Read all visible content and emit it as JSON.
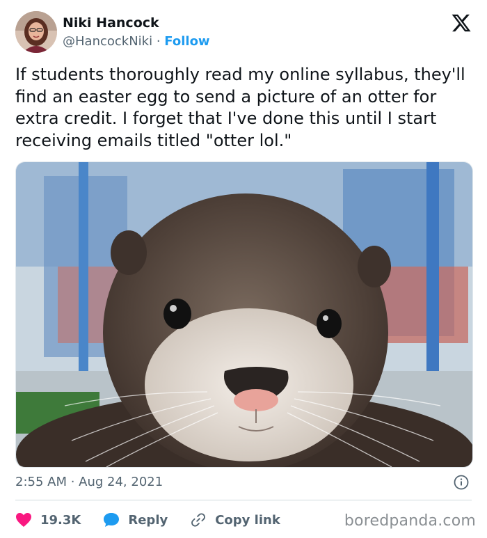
{
  "author": {
    "name": "Niki Hancock",
    "handle": "@HancockNiki",
    "separator": "·",
    "follow_label": "Follow"
  },
  "tweet": {
    "text": "If students thoroughly read my online syllabus, they'll find an easter egg to send a picture of an otter for extra credit. I forget that I've done this until I start receiving emails titled \"otter lol.\"",
    "timestamp": "2:55 AM · Aug 24, 2021"
  },
  "actions": {
    "likes": "19.3K",
    "reply_label": "Reply",
    "copy_link_label": "Copy link"
  },
  "icons": {
    "platform": "x-logo-icon",
    "info": "info-icon",
    "like": "heart-icon",
    "reply": "reply-bubble-icon",
    "copy": "link-icon"
  },
  "colors": {
    "follow": "#1d9bf0",
    "like": "#f91880",
    "reply": "#1d9bf0",
    "muted": "#536471"
  },
  "watermark": "boredpanda.com"
}
